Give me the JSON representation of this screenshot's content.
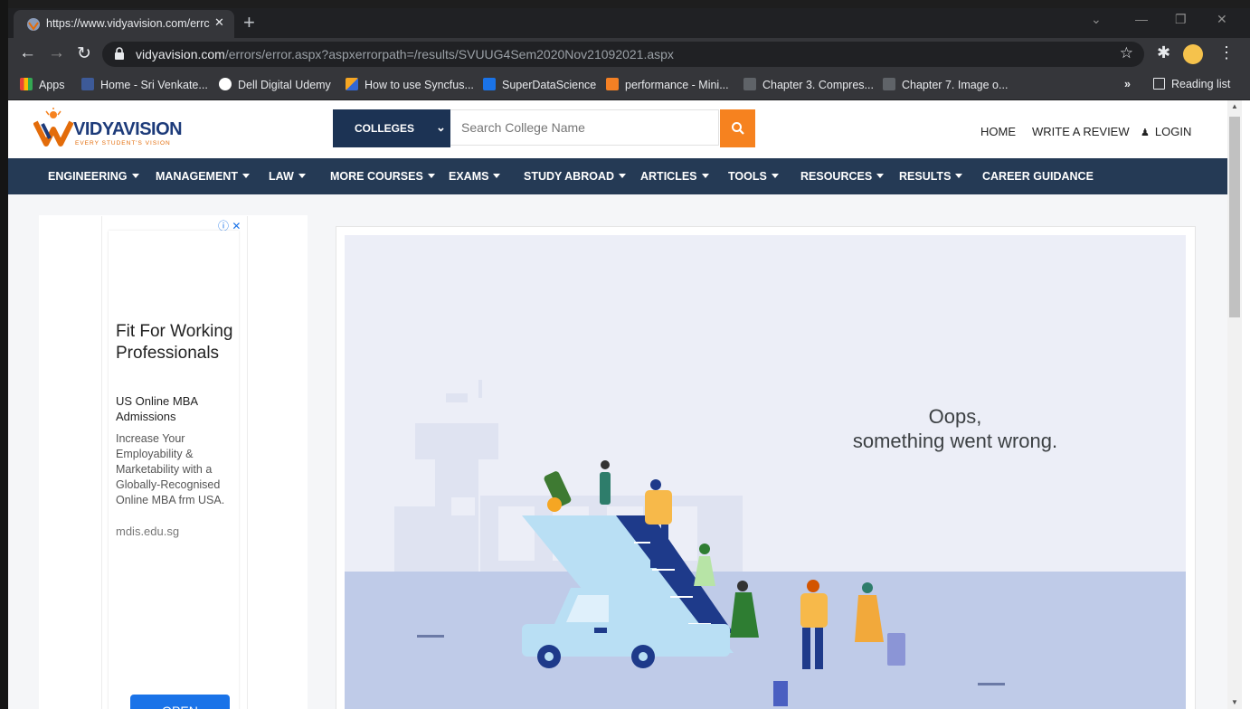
{
  "browser": {
    "tab_title": "https://www.vidyavision.com/errc",
    "url_host": "vidyavision.com",
    "url_path": "/errors/error.aspx?aspxerrorpath=/results/SVUUG4Sem2020Nov21092021.aspx",
    "bookmarks": [
      {
        "label": "Apps",
        "icon": "apps-grid-icon"
      },
      {
        "label": "Home - Sri Venkate...",
        "icon": "university-icon"
      },
      {
        "label": "Dell Digital Udemy",
        "icon": "dell-icon"
      },
      {
        "label": "How to use Syncfus...",
        "icon": "syncfusion-icon"
      },
      {
        "label": "SuperDataScience",
        "icon": "sds-icon"
      },
      {
        "label": "performance - Mini...",
        "icon": "stackoverflow-icon"
      },
      {
        "label": "Chapter 3. Compres...",
        "icon": "doc-icon"
      },
      {
        "label": "Chapter 7. Image o...",
        "icon": "doc-icon"
      }
    ],
    "overflow_label": "»",
    "reading_list": "Reading list"
  },
  "site": {
    "logo_text": "VIDYAVISION",
    "logo_tagline": "EVERY STUDENT'S VISION",
    "search_category": "COLLEGES",
    "search_placeholder": "Search College Name",
    "header_links": [
      "HOME",
      "WRITE A REVIEW",
      "LOGIN"
    ],
    "nav": [
      {
        "label": "ENGINEERING",
        "dropdown": true
      },
      {
        "label": "MANAGEMENT",
        "dropdown": true
      },
      {
        "label": "LAW",
        "dropdown": true
      },
      {
        "label": "MORE COURSES",
        "dropdown": true
      },
      {
        "label": "EXAMS",
        "dropdown": true
      },
      {
        "label": "STUDY ABROAD",
        "dropdown": true
      },
      {
        "label": "ARTICLES",
        "dropdown": true
      },
      {
        "label": "TOOLS",
        "dropdown": true
      },
      {
        "label": "RESOURCES",
        "dropdown": true
      },
      {
        "label": "RESULTS",
        "dropdown": true
      },
      {
        "label": "CAREER GUIDANCE",
        "dropdown": false
      }
    ]
  },
  "ad": {
    "headline": "Fit For Working Professionals",
    "sub": "US Online MBA Admissions",
    "desc": "Increase Your Employability & Marketability with a Globally-Recognised Online MBA frm USA.",
    "domain": "mdis.edu.sg",
    "button": "OPEN"
  },
  "error": {
    "line1": "Oops,",
    "line2": "something went wrong."
  },
  "colors": {
    "nav_bg": "#253a55",
    "search_btn": "#f6821f",
    "ad_button": "#1a73e8"
  }
}
